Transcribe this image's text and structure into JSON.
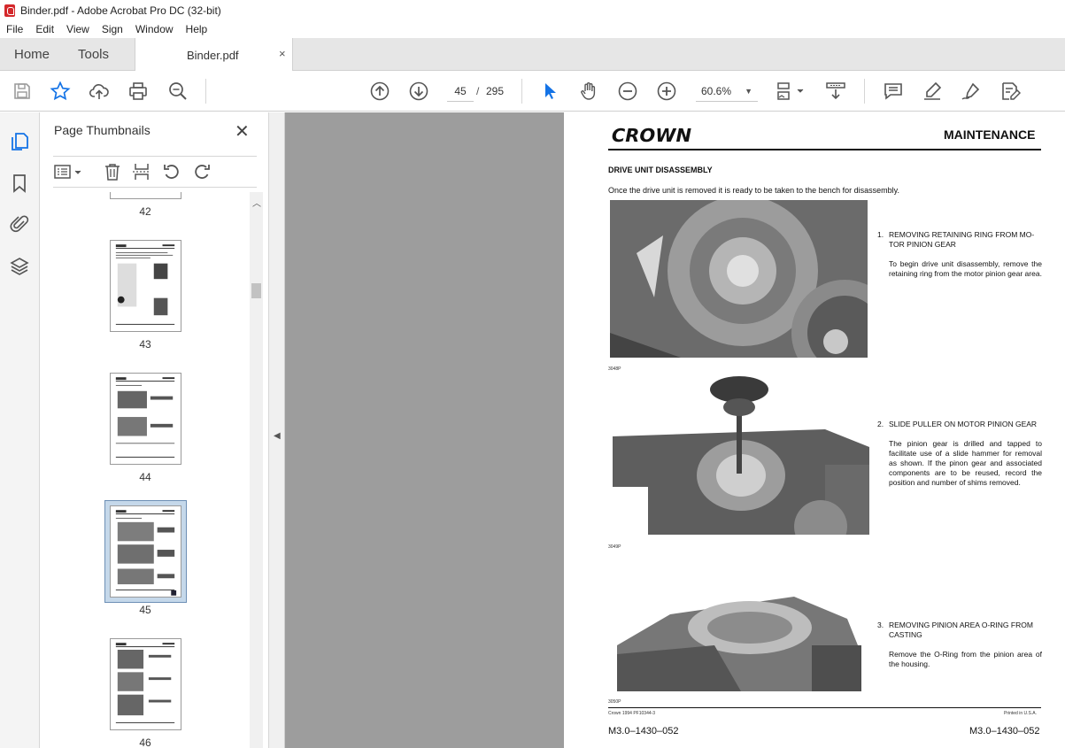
{
  "window": {
    "title": "Binder.pdf - Adobe Acrobat Pro DC (32-bit)"
  },
  "menu": [
    "File",
    "Edit",
    "View",
    "Sign",
    "Window",
    "Help"
  ],
  "tabs": {
    "home": "Home",
    "tools": "Tools",
    "document": "Binder.pdf",
    "close": "×"
  },
  "toolbar": {
    "current_page": "45",
    "separator": "/",
    "total_pages": "295",
    "zoom": "60.6%"
  },
  "panel": {
    "title": "Page Thumbnails",
    "close": "✕",
    "thumbnails": [
      {
        "label": "42"
      },
      {
        "label": "43"
      },
      {
        "label": "44"
      },
      {
        "label": "45",
        "selected": true
      },
      {
        "label": "46"
      }
    ]
  },
  "document_page": {
    "logo": "CROWN",
    "header": "MAINTENANCE",
    "section_title": "DRIVE UNIT DISASSEMBLY",
    "intro": "Once the drive unit is removed it is ready to be taken to the bench for disassembly.",
    "steps": [
      {
        "num": "1.",
        "head": "REMOVING RETAINING RING FROM MO-TOR PINION GEAR",
        "body": "To begin drive unit disassembly, remove the retaining ring from the motor pinion gear area.",
        "photo_code": "3048P"
      },
      {
        "num": "2.",
        "head": "SLIDE PULLER ON MOTOR PINION GEAR",
        "body": "The pinion gear is drilled and tapped to facilitate use of a slide hammer for removal as shown. If the pinon gear and associated components are to be reused, record the position and number of shims removed.",
        "photo_code": "3049P"
      },
      {
        "num": "3.",
        "head": "REMOVING PINION AREA O-RING FROM CASTING",
        "body": "Remove the O-Ring from the pinion area of the housing.",
        "photo_code": "3050P"
      }
    ],
    "footer_left_small": "Crown 1994 PF10344-3",
    "footer_right_small": "Printed in U.S.A.",
    "footer_left": "M3.0–1430–052",
    "footer_right": "M3.0–1430–052"
  },
  "icons": {
    "toolbar": [
      "save-icon",
      "star-icon",
      "upload-icon",
      "print-icon",
      "search-zoom-icon",
      "page-up-icon",
      "page-down-icon",
      "select-cursor-icon",
      "hand-icon",
      "zoom-out-icon",
      "zoom-in-icon",
      "page-fit-icon",
      "scroll-mode-icon",
      "comment-icon",
      "highlight-icon",
      "sign-icon",
      "edit-pdf-icon"
    ],
    "rail": [
      "thumbnails-icon",
      "bookmark-icon",
      "attachment-icon",
      "layers-icon"
    ]
  },
  "colors": {
    "accent": "#1473e6",
    "selected_thumb": "#c5d8ea",
    "workspace_gray": "#9d9d9d"
  }
}
